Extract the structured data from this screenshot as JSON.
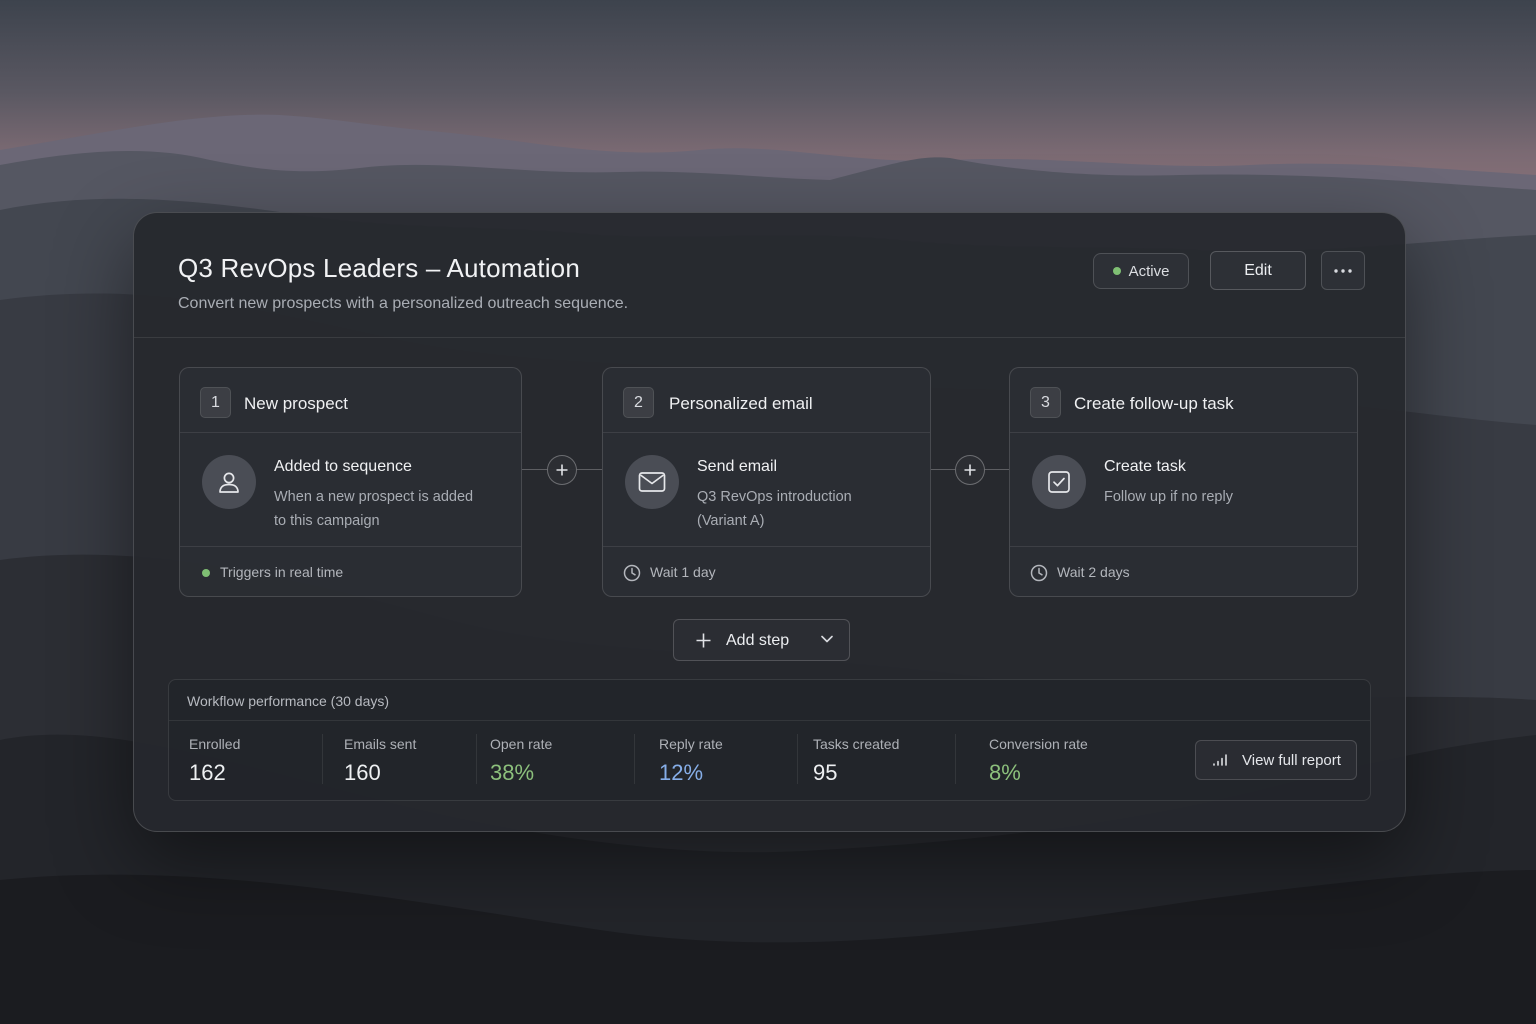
{
  "colors": {
    "active_green": "#7fbf73",
    "positive_green": "#8cc07c",
    "info_blue": "#86aee8"
  },
  "header": {
    "title": "Q3 RevOps Leaders – Automation",
    "subtitle": "Convert new prospects with a personalized outreach sequence.",
    "status": "Active",
    "edit_label": "Edit",
    "more_icon": "more-horizontal-icon"
  },
  "steps": [
    {
      "number": "1",
      "title": "New prospect",
      "icon": "user-icon",
      "action": "Added to sequence",
      "description": "When a new prospect is added to this campaign",
      "footer": "Triggers in real time",
      "footer_icon": "green-dot"
    },
    {
      "number": "2",
      "title": "Personalized email",
      "icon": "mail-icon",
      "action": "Send email",
      "description": "Q3 RevOps introduction (Variant A)",
      "footer": "Wait 1 day",
      "footer_icon": "clock-icon"
    },
    {
      "number": "3",
      "title": "Create follow-up task",
      "icon": "checkbox-icon",
      "action": "Create task",
      "description": "Follow up if no reply",
      "footer": "Wait 2 days",
      "footer_icon": "clock-icon"
    }
  ],
  "add_step": {
    "label": "Add step"
  },
  "performance": {
    "title": "Workflow performance (30 days)",
    "metrics": [
      {
        "label": "Enrolled",
        "value": "162"
      },
      {
        "label": "Emails sent",
        "value": "160"
      },
      {
        "label": "Open rate",
        "value": "38%"
      },
      {
        "label": "Reply rate",
        "value": "12%"
      },
      {
        "label": "Tasks created",
        "value": "95"
      },
      {
        "label": "Conversion rate",
        "value": "8%"
      }
    ],
    "report_label": "View full report"
  }
}
